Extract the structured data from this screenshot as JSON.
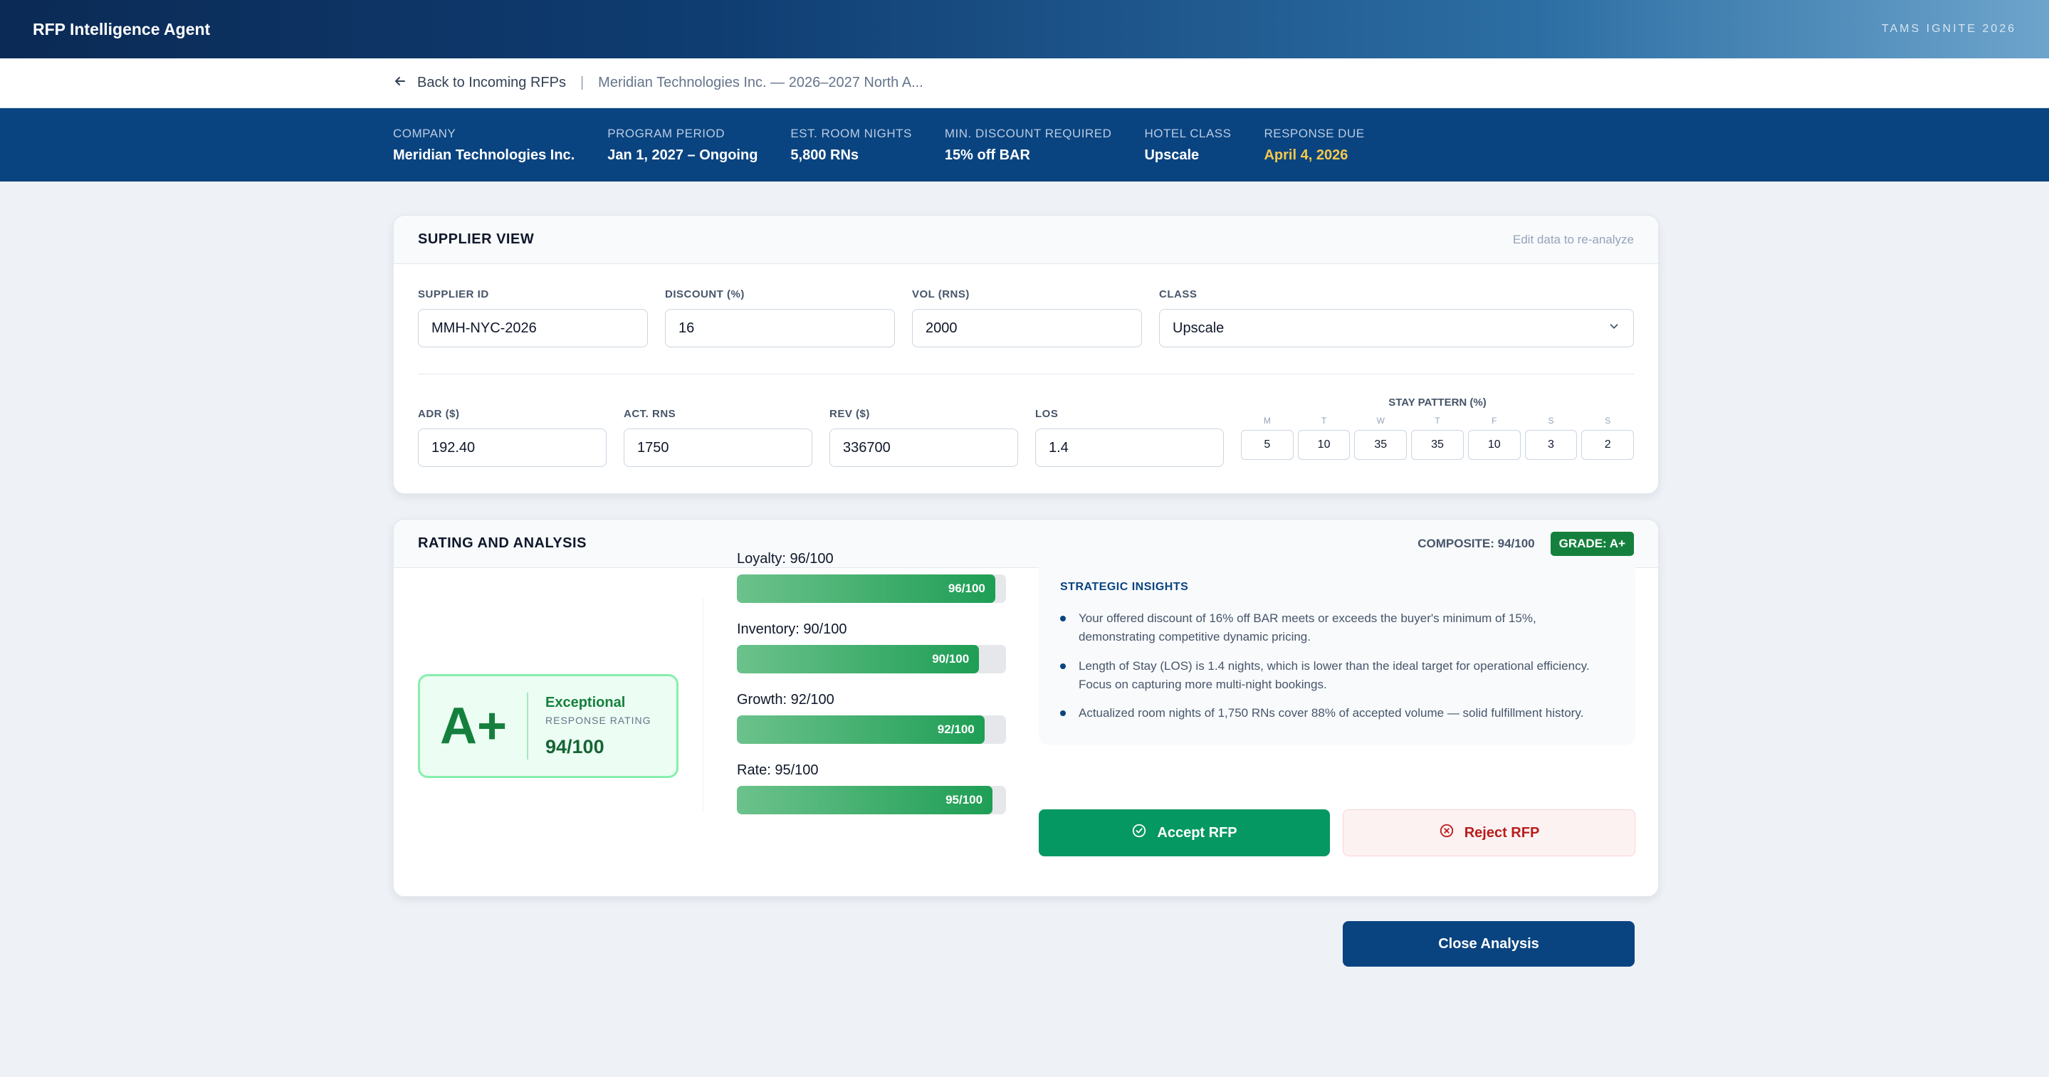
{
  "app": {
    "title": "RFP Intelligence Agent",
    "event": "TAMS IGNITE 2026"
  },
  "breadcrumb": {
    "back_label": "Back to Incoming RFPs",
    "current": "Meridian Technologies Inc. — 2026–2027 North A..."
  },
  "info": [
    {
      "label": "COMPANY",
      "value": "Meridian Technologies Inc."
    },
    {
      "label": "PROGRAM PERIOD",
      "value": "Jan 1, 2027 – Ongoing"
    },
    {
      "label": "EST. ROOM NIGHTS",
      "value": "5,800 RNs"
    },
    {
      "label": "MIN. DISCOUNT REQUIRED",
      "value": "15% off BAR"
    },
    {
      "label": "HOTEL CLASS",
      "value": "Upscale"
    },
    {
      "label": "RESPONSE DUE",
      "value": "April 4, 2026"
    }
  ],
  "supplier": {
    "title": "SUPPLIER VIEW",
    "hint": "Edit data to re-analyze",
    "fields": [
      {
        "label": "SUPPLIER ID",
        "value": "MMH-NYC-2026"
      },
      {
        "label": "DISCOUNT (%)",
        "value": "16"
      },
      {
        "label": "VOL (RNS)",
        "value": "2000"
      },
      {
        "label": "CLASS",
        "value": "Upscale"
      }
    ],
    "fields2": [
      {
        "label": "ADR ($)",
        "value": "192.40"
      },
      {
        "label": "ACT. RNS",
        "value": "1750"
      },
      {
        "label": "REV ($)",
        "value": "336700"
      },
      {
        "label": "LOS",
        "value": "1.4"
      }
    ],
    "stay_pattern": {
      "label": "STAY PATTERN (%)",
      "days": [
        {
          "day": "M",
          "value": "5"
        },
        {
          "day": "T",
          "value": "10"
        },
        {
          "day": "W",
          "value": "35"
        },
        {
          "day": "T",
          "value": "35"
        },
        {
          "day": "F",
          "value": "10"
        },
        {
          "day": "S",
          "value": "3"
        },
        {
          "day": "S",
          "value": "2"
        }
      ]
    }
  },
  "rating": {
    "title": "RATING AND ANALYSIS",
    "composite": "COMPOSITE: 94/100",
    "grade_badge": "GRADE: A+",
    "grade": "A+",
    "grade_name": "Exceptional",
    "grade_sub": "RESPONSE RATING",
    "grade_score": "94/100",
    "bars": [
      {
        "label": "Loyalty: 96/100",
        "value": 96,
        "text": "96/100"
      },
      {
        "label": "Inventory: 90/100",
        "value": 90,
        "text": "90/100"
      },
      {
        "label": "Growth: 92/100",
        "value": 92,
        "text": "92/100"
      },
      {
        "label": "Rate: 95/100",
        "value": 95,
        "text": "95/100"
      }
    ],
    "insights_title": "STRATEGIC INSIGHTS",
    "insights": [
      "Your offered discount of 16% off BAR meets or exceeds the buyer's minimum of 15%, demonstrating competitive dynamic pricing.",
      "Length of Stay (LOS) is 1.4 nights, which is lower than the ideal target for operational efficiency. Focus on capturing more multi-night bookings.",
      "Actualized room nights of 1,750 RNs cover 88% of accepted volume — solid fulfillment history."
    ],
    "accept_label": "Accept RFP",
    "reject_label": "Reject RFP"
  },
  "close_label": "Close Analysis",
  "colors": {
    "primary": "#0a4480",
    "success": "#059862",
    "grade": "#15803d",
    "due": "#f7c94b",
    "reject": "#b91c1c"
  }
}
